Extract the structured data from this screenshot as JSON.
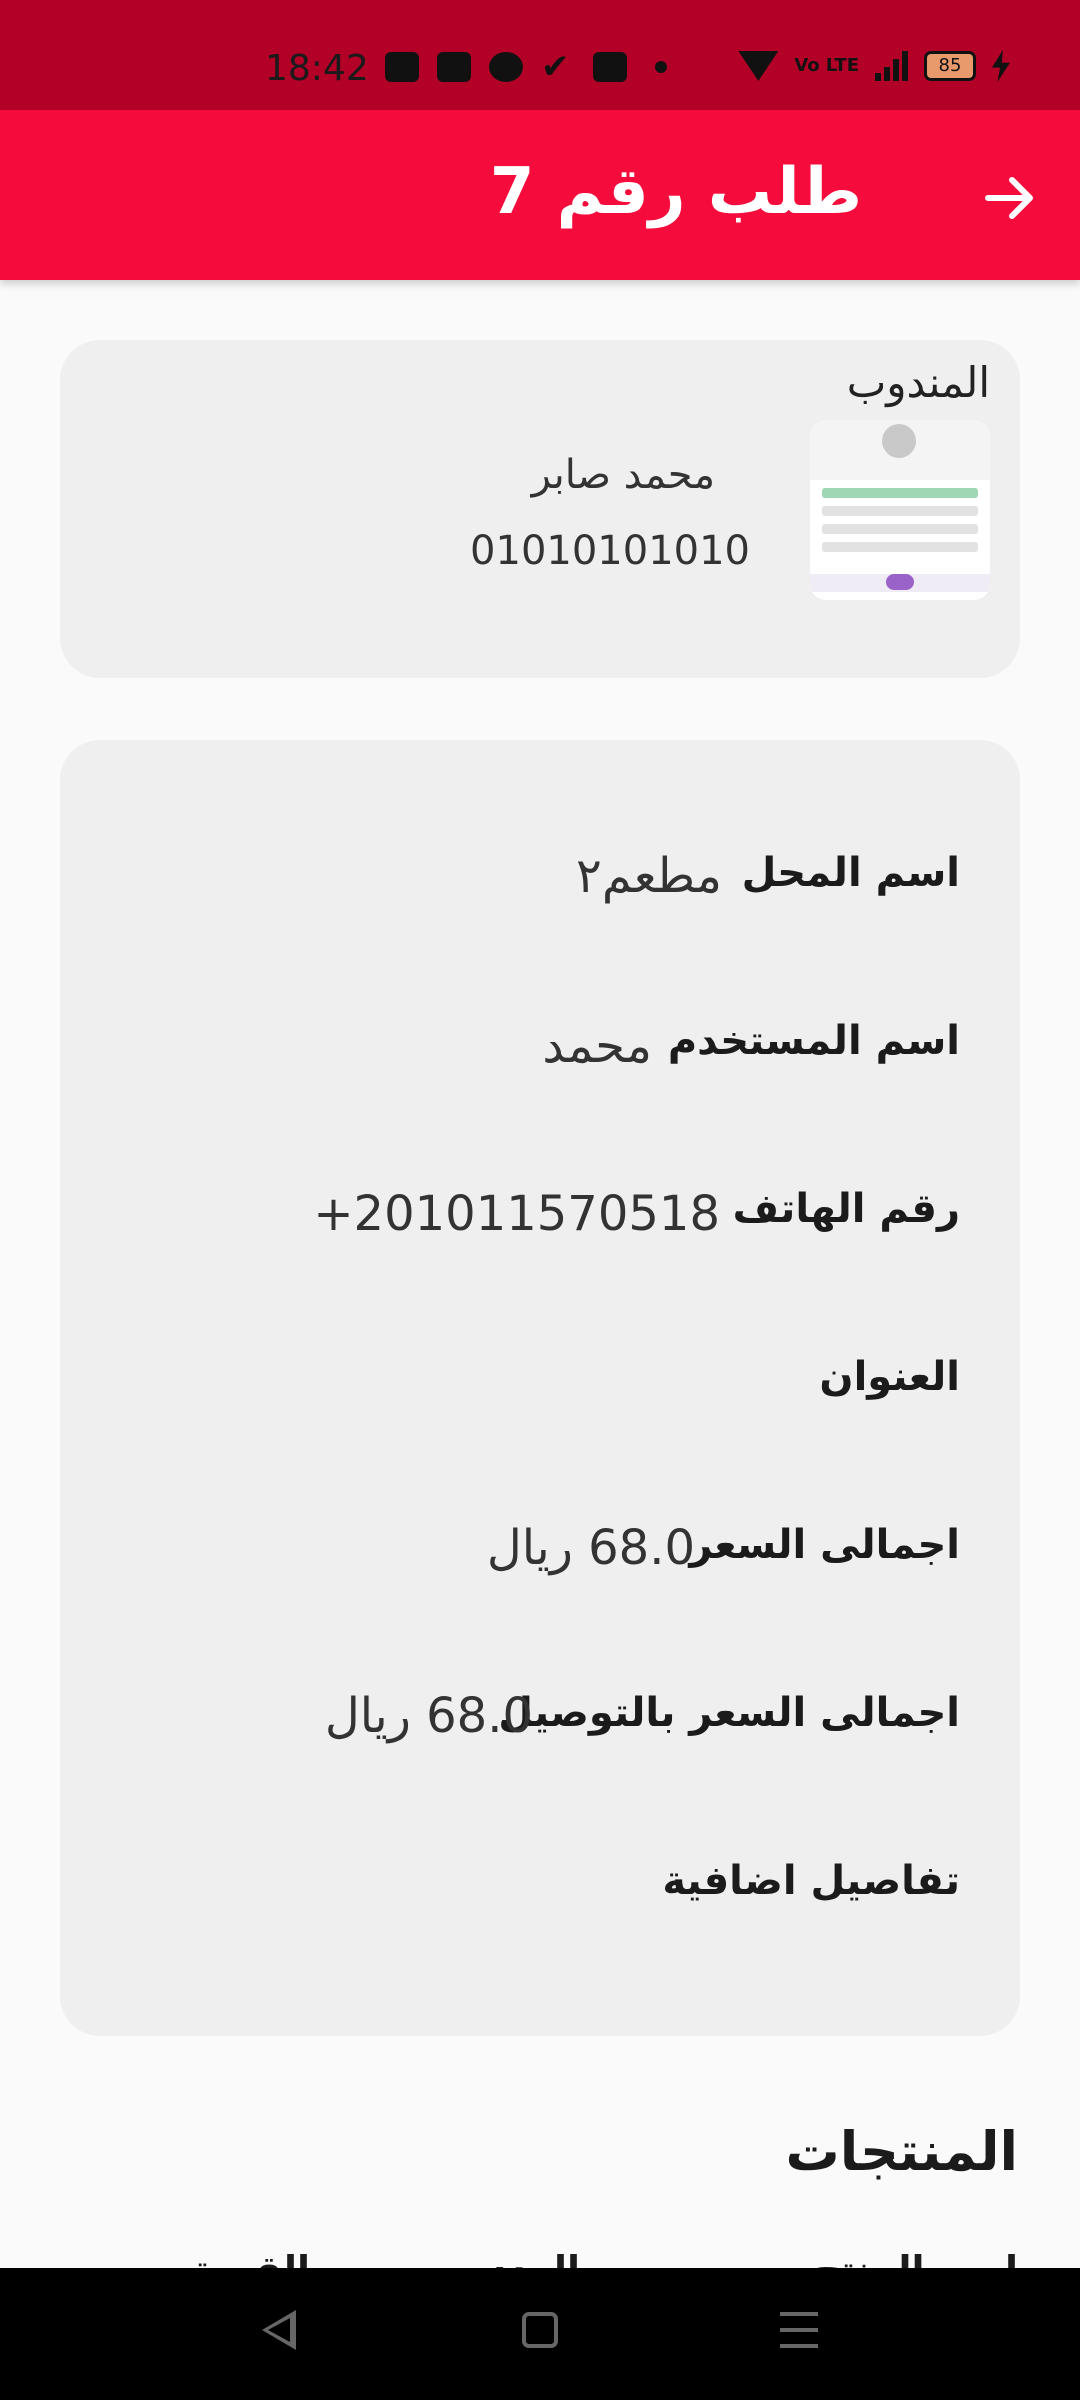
{
  "status_bar": {
    "time": "18:42",
    "volte": "Vo LTE",
    "battery": "85"
  },
  "app_bar": {
    "title": "طلب رقم 7",
    "back_icon": "arrow-right-icon",
    "color": "#f50c3c"
  },
  "delegate": {
    "label": "المندوب",
    "name": "محمد صابر",
    "phone": "01010101010"
  },
  "details": [
    {
      "label": "اسم المحل",
      "value": "مطعم٢"
    },
    {
      "label": "اسم المستخدم",
      "value": "محمد"
    },
    {
      "label": "رقم الهاتف",
      "value": "201011570518+"
    },
    {
      "label": "العنوان",
      "value": ""
    },
    {
      "label": "اجمالى السعر",
      "value": "68.0 ريال"
    },
    {
      "label": "اجمالى السعر بالتوصيل",
      "value": "68.0 ريال"
    },
    {
      "label": "تفاصيل اضافية",
      "value": ""
    }
  ],
  "products": {
    "heading": "المنتجات",
    "columns": [
      "اسم المنتج",
      "العدد",
      "القيمة"
    ]
  }
}
